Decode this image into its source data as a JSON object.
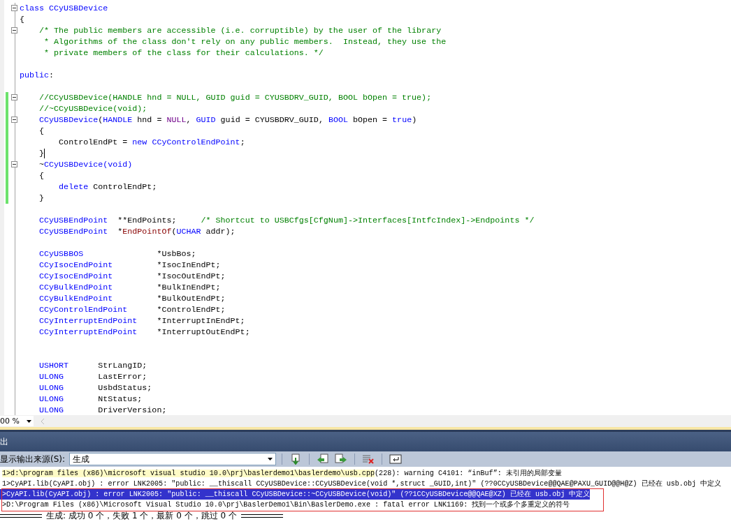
{
  "editor": {
    "lines": [
      {
        "fold": true,
        "changed": false,
        "caret": false,
        "tokens": [
          {
            "kind": "kw",
            "text": "class CCyUSBDevice"
          }
        ]
      },
      {
        "fold": false,
        "changed": false,
        "caret": false,
        "tokens": [
          {
            "kind": "tx",
            "text": "{"
          }
        ]
      },
      {
        "fold": true,
        "changed": false,
        "caret": false,
        "tokens": [
          {
            "kind": "cm",
            "text": "    /* The public members are accessible (i.e. corruptible) by the user of the library"
          }
        ]
      },
      {
        "fold": false,
        "changed": false,
        "caret": false,
        "tokens": [
          {
            "kind": "cm",
            "text": "     * Algorithms of the class don't rely on any public members.  Instead, they use the"
          }
        ]
      },
      {
        "fold": false,
        "changed": false,
        "caret": false,
        "tokens": [
          {
            "kind": "cm",
            "text": "     * private members of the class for their calculations. */"
          }
        ]
      },
      {
        "fold": false,
        "changed": false,
        "caret": false
      },
      {
        "fold": false,
        "changed": false,
        "caret": false,
        "tokens": [
          {
            "kind": "kw",
            "text": "public"
          },
          {
            "kind": "tx",
            "text": ":"
          }
        ]
      },
      {
        "fold": false,
        "changed": false,
        "caret": false
      },
      {
        "fold": true,
        "changed": true,
        "caret": false,
        "tokens": [
          {
            "kind": "cm",
            "text": "    //CCyUSBDevice(HANDLE hnd = NULL, GUID guid = CYUSBDRV_GUID, BOOL bOpen = true);"
          }
        ]
      },
      {
        "fold": false,
        "changed": true,
        "caret": false,
        "tokens": [
          {
            "kind": "cm",
            "text": "    //~CCyUSBDevice(void);"
          }
        ]
      },
      {
        "fold": true,
        "changed": true,
        "caret": false,
        "tokens": [
          {
            "kind": "kw",
            "text": "    CCyUSBDevice"
          },
          {
            "kind": "tx",
            "text": "("
          },
          {
            "kind": "kw",
            "text": "HANDLE"
          },
          {
            "kind": "tx",
            "text": " hnd = "
          },
          {
            "kind": "mc",
            "text": "NULL"
          },
          {
            "kind": "tx",
            "text": ", "
          },
          {
            "kind": "kw",
            "text": "GUID"
          },
          {
            "kind": "tx",
            "text": " guid = CYUSBDRV_GUID, "
          },
          {
            "kind": "kw",
            "text": "BOOL"
          },
          {
            "kind": "tx",
            "text": " bOpen = "
          },
          {
            "kind": "kw",
            "text": "true"
          },
          {
            "kind": "tx",
            "text": ")"
          }
        ]
      },
      {
        "fold": false,
        "changed": true,
        "caret": false,
        "tokens": [
          {
            "kind": "tx",
            "text": "    {"
          }
        ]
      },
      {
        "fold": false,
        "changed": true,
        "caret": false,
        "tokens": [
          {
            "kind": "tx",
            "text": "        ControlEndPt = "
          },
          {
            "kind": "kw",
            "text": "new CCyControlEndPoint"
          },
          {
            "kind": "tx",
            "text": ";"
          }
        ]
      },
      {
        "fold": false,
        "changed": true,
        "caret": true,
        "tokens": [
          {
            "kind": "tx",
            "text": "    }"
          }
        ]
      },
      {
        "fold": true,
        "changed": true,
        "caret": false,
        "tokens": [
          {
            "kind": "tx",
            "text": "    ~"
          },
          {
            "kind": "kw",
            "text": "CCyUSBDevice(void)"
          }
        ]
      },
      {
        "fold": false,
        "changed": true,
        "caret": false,
        "tokens": [
          {
            "kind": "tx",
            "text": "    {"
          }
        ]
      },
      {
        "fold": false,
        "changed": true,
        "caret": false,
        "tokens": [
          {
            "kind": "kw",
            "text": "        delete"
          },
          {
            "kind": "tx",
            "text": " ControlEndPt;"
          }
        ]
      },
      {
        "fold": false,
        "changed": true,
        "caret": false,
        "tokens": [
          {
            "kind": "tx",
            "text": "    }"
          }
        ]
      },
      {
        "fold": false,
        "changed": false,
        "caret": false
      },
      {
        "fold": false,
        "changed": false,
        "caret": false,
        "tokens": [
          {
            "kind": "kw",
            "text": "    CCyUSBEndPoint"
          },
          {
            "kind": "tx",
            "text": "  **EndPoints;     "
          },
          {
            "kind": "cm",
            "text": "/* Shortcut to USBCfgs[CfgNum]->Interfaces[IntfcIndex]->Endpoints */"
          }
        ]
      },
      {
        "fold": false,
        "changed": false,
        "caret": false,
        "tokens": [
          {
            "kind": "kw",
            "text": "    CCyUSBEndPoint"
          },
          {
            "kind": "tx",
            "text": "  *"
          },
          {
            "kind": "fn",
            "text": "EndPointOf"
          },
          {
            "kind": "tx",
            "text": "("
          },
          {
            "kind": "kw",
            "text": "UCHAR"
          },
          {
            "kind": "tx",
            "text": " addr);"
          }
        ]
      },
      {
        "fold": false,
        "changed": false,
        "caret": false
      },
      {
        "fold": false,
        "changed": false,
        "caret": false,
        "tokens": [
          {
            "kind": "kw",
            "text": "    CCyUSBBOS"
          },
          {
            "kind": "tx",
            "text": "               *UsbBos;"
          }
        ]
      },
      {
        "fold": false,
        "changed": false,
        "caret": false,
        "tokens": [
          {
            "kind": "kw",
            "text": "    CCyIsocEndPoint"
          },
          {
            "kind": "tx",
            "text": "         *IsocInEndPt;"
          }
        ]
      },
      {
        "fold": false,
        "changed": false,
        "caret": false,
        "tokens": [
          {
            "kind": "kw",
            "text": "    CCyIsocEndPoint"
          },
          {
            "kind": "tx",
            "text": "         *IsocOutEndPt;"
          }
        ]
      },
      {
        "fold": false,
        "changed": false,
        "caret": false,
        "tokens": [
          {
            "kind": "kw",
            "text": "    CCyBulkEndPoint"
          },
          {
            "kind": "tx",
            "text": "         *BulkInEndPt;"
          }
        ]
      },
      {
        "fold": false,
        "changed": false,
        "caret": false,
        "tokens": [
          {
            "kind": "kw",
            "text": "    CCyBulkEndPoint"
          },
          {
            "kind": "tx",
            "text": "         *BulkOutEndPt;"
          }
        ]
      },
      {
        "fold": false,
        "changed": false,
        "caret": false,
        "tokens": [
          {
            "kind": "kw",
            "text": "    CCyControlEndPoint"
          },
          {
            "kind": "tx",
            "text": "      *ControlEndPt;"
          }
        ]
      },
      {
        "fold": false,
        "changed": false,
        "caret": false,
        "tokens": [
          {
            "kind": "kw",
            "text": "    CCyInterruptEndPoint"
          },
          {
            "kind": "tx",
            "text": "    *InterruptInEndPt;"
          }
        ]
      },
      {
        "fold": false,
        "changed": false,
        "caret": false,
        "tokens": [
          {
            "kind": "kw",
            "text": "    CCyInterruptEndPoint"
          },
          {
            "kind": "tx",
            "text": "    *InterruptOutEndPt;"
          }
        ]
      },
      {
        "fold": false,
        "changed": false,
        "caret": false
      },
      {
        "fold": false,
        "changed": false,
        "caret": false
      },
      {
        "fold": false,
        "changed": false,
        "caret": false,
        "tokens": [
          {
            "kind": "kw",
            "text": "    USHORT"
          },
          {
            "kind": "tx",
            "text": "      StrLangID;"
          }
        ]
      },
      {
        "fold": false,
        "changed": false,
        "caret": false,
        "tokens": [
          {
            "kind": "kw",
            "text": "    ULONG"
          },
          {
            "kind": "tx",
            "text": "       LastError;"
          }
        ]
      },
      {
        "fold": false,
        "changed": false,
        "caret": false,
        "tokens": [
          {
            "kind": "kw",
            "text": "    ULONG"
          },
          {
            "kind": "tx",
            "text": "       UsbdStatus;"
          }
        ]
      },
      {
        "fold": false,
        "changed": false,
        "caret": false,
        "tokens": [
          {
            "kind": "kw",
            "text": "    ULONG"
          },
          {
            "kind": "tx",
            "text": "       NtStatus;"
          }
        ]
      },
      {
        "fold": false,
        "changed": false,
        "caret": false,
        "tokens": [
          {
            "kind": "kw",
            "text": "    ULONG"
          },
          {
            "kind": "tx",
            "text": "       DriverVersion;"
          }
        ]
      }
    ]
  },
  "zoom": {
    "value": "00 %"
  },
  "output_panel": {
    "title": "出",
    "source_label": "显示输出来源(S):",
    "source_value": "生成",
    "lines": [
      {
        "selected": false,
        "segments": [
          {
            "highlighted": true,
            "text": "1>d:\\program files (x86)\\microsoft visual studio 10.0\\prj\\baslerdemo1\\baslerdemo\\usb.cpp"
          },
          {
            "highlighted": false,
            "text": "(228): warning C4101: “inBuf”: 未引用的局部变量"
          }
        ]
      },
      {
        "selected": false,
        "segments": [
          {
            "highlighted": false,
            "text": "1>CyAPI.lib(CyAPI.obj) : error LNK2005: \"public: __thiscall CCyUSBDevice::CCyUSBDevice(void *,struct _GUID,int)\" (??0CCyUSBDevice@@QAE@PAXU_GUID@@H@Z) 已经在 usb.obj 中定义"
          }
        ]
      },
      {
        "selected": true,
        "segments": [
          {
            "highlighted": false,
            "text": ">CyAPI.lib(CyAPI.obj) : error LNK2005: \"public: __thiscall CCyUSBDevice::~CCyUSBDevice(void)\" (??1CCyUSBDevice@@QAE@XZ) 已经在 usb.obj 中定义"
          }
        ]
      },
      {
        "selected": false,
        "segments": [
          {
            "highlighted": false,
            "text": ">D:\\Program Files (x86)\\Microsoft Visual Studio 10.0\\prj\\BaslerDemo1\\Bin\\BaslerDemo.exe : fatal error LNK1169: 找到一个或多个多重定义的符号"
          }
        ]
      }
    ],
    "summary": "生成: 成功 0 个，失败 1 个，最新 0 个，跳过 0 个"
  }
}
